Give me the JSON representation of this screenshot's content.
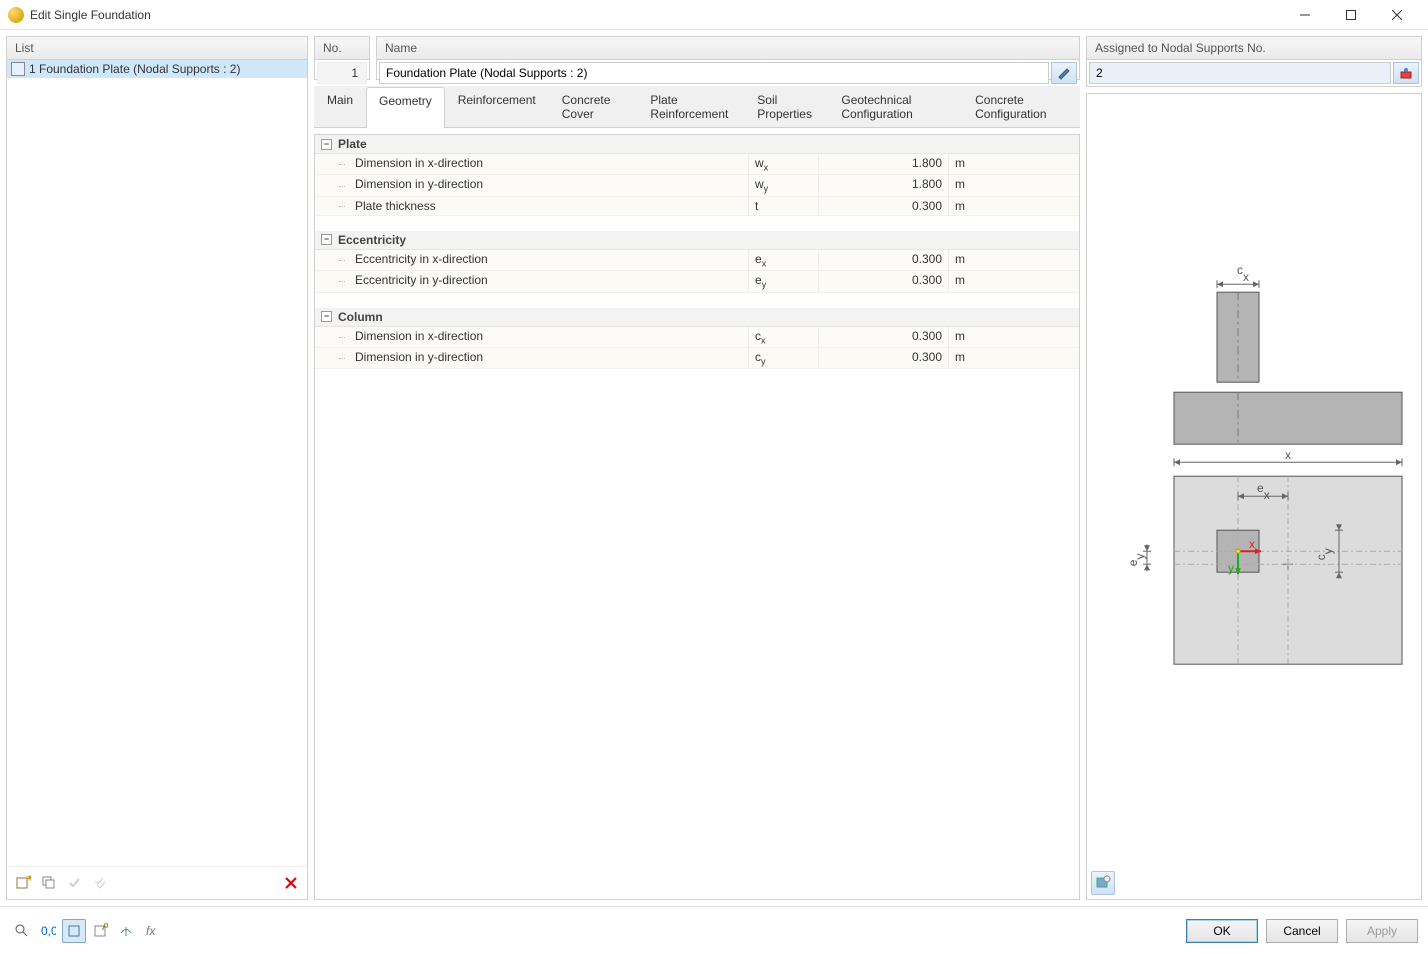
{
  "window": {
    "title": "Edit Single Foundation"
  },
  "left": {
    "header": "List",
    "item": "1  Foundation Plate (Nodal Supports : 2)"
  },
  "header": {
    "no_label": "No.",
    "no_value": "1",
    "name_label": "Name",
    "name_value": "Foundation Plate (Nodal Supports : 2)"
  },
  "assigned": {
    "label": "Assigned to Nodal Supports No.",
    "value": "2"
  },
  "tabs": {
    "main": "Main",
    "geometry": "Geometry",
    "reinforcement": "Reinforcement",
    "cover": "Concrete Cover",
    "plate_reinforcement": "Plate Reinforcement",
    "soil": "Soil Properties",
    "geotech": "Geotechnical Configuration",
    "concrete": "Concrete Configuration"
  },
  "groups": {
    "plate": {
      "title": "Plate",
      "rows": [
        {
          "label": "Dimension in x-direction",
          "sym": "w<sub>x</sub>",
          "val": "1.800",
          "unit": "m"
        },
        {
          "label": "Dimension in y-direction",
          "sym": "w<sub>y</sub>",
          "val": "1.800",
          "unit": "m"
        },
        {
          "label": "Plate thickness",
          "sym": "t",
          "val": "0.300",
          "unit": "m"
        }
      ]
    },
    "ecc": {
      "title": "Eccentricity",
      "rows": [
        {
          "label": "Eccentricity in x-direction",
          "sym": "e<sub>x</sub>",
          "val": "0.300",
          "unit": "m"
        },
        {
          "label": "Eccentricity in y-direction",
          "sym": "e<sub>y</sub>",
          "val": "0.300",
          "unit": "m"
        }
      ]
    },
    "col": {
      "title": "Column",
      "rows": [
        {
          "label": "Dimension in x-direction",
          "sym": "c<sub>x</sub>",
          "val": "0.300",
          "unit": "m"
        },
        {
          "label": "Dimension in y-direction",
          "sym": "c<sub>y</sub>",
          "val": "0.300",
          "unit": "m"
        }
      ]
    }
  },
  "buttons": {
    "ok": "OK",
    "cancel": "Cancel",
    "apply": "Apply"
  }
}
